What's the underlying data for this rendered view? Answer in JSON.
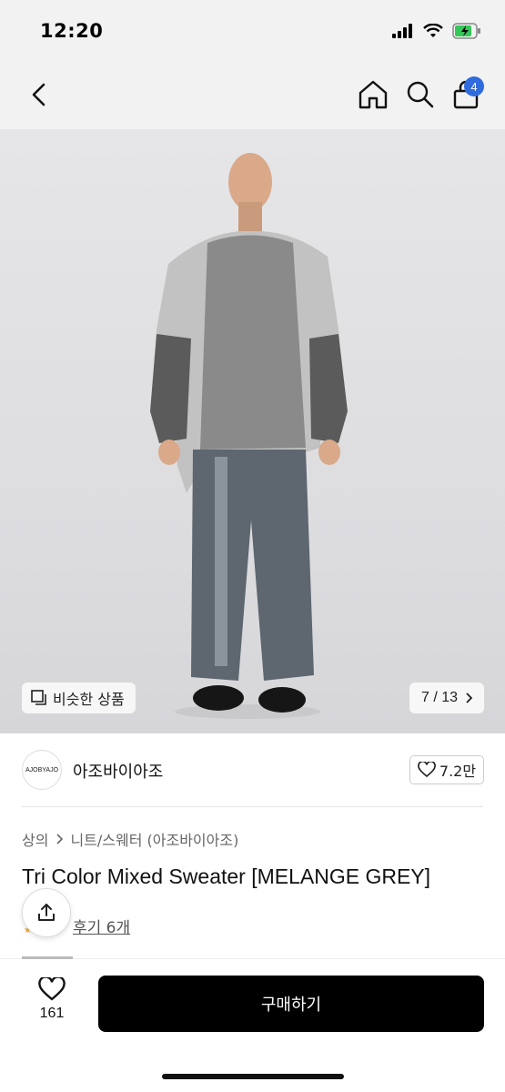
{
  "status_bar": {
    "time": "12:20"
  },
  "nav": {
    "cart_count": "4"
  },
  "gallery": {
    "similar_label": "비슷한 상품",
    "page_indicator": "7 / 13"
  },
  "brand": {
    "logo_text": "AJOBYAJO",
    "name": "아조바이아조",
    "likes": "7.2만"
  },
  "product": {
    "breadcrumb": [
      "상의",
      "니트/스웨터 (아조바이아조)"
    ],
    "title": "Tri Color Mixed Sweater [MELANGE GREY]",
    "review_link": "후기 6개"
  },
  "bottom_bar": {
    "wish_count": "161",
    "buy_label": "구매하기"
  },
  "colors": {
    "accent_badge": "#2f6bdc",
    "buy_button": "#000000"
  },
  "icons": [
    "back-icon",
    "home-icon",
    "search-icon",
    "cart-icon",
    "similar-icon",
    "chevron-right-icon",
    "heart-icon",
    "share-icon",
    "signal-icon",
    "wifi-icon",
    "battery-icon"
  ]
}
